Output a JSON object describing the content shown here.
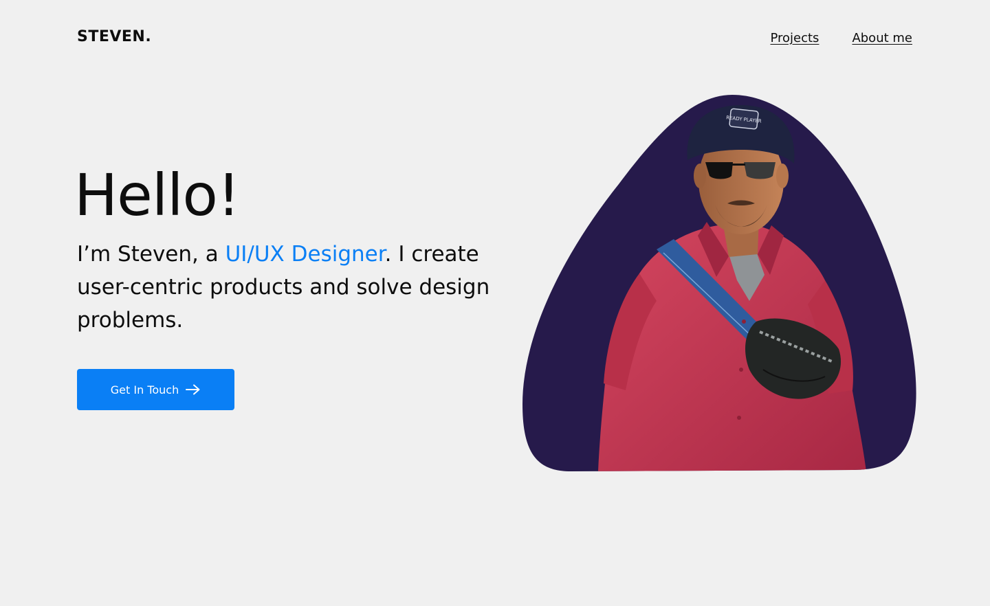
{
  "header": {
    "logo": "STEVEN.",
    "nav": [
      {
        "label": "Projects"
      },
      {
        "label": "About me"
      }
    ]
  },
  "hero": {
    "title": "Hello!",
    "intro_prefix": "I’m Steven, a ",
    "intro_accent": "UI/UX Designer",
    "intro_suffix": ". I  create user-centric products and solve design problems.",
    "cta_label": "Get In Touch",
    "cta_icon": "arrow-right-icon"
  },
  "illustration": {
    "subject": "avatar-illustration",
    "beanie_text": "READY PLAYER"
  },
  "colors": {
    "background": "#f0f0f0",
    "accent": "#0a7ff5",
    "blob": "#261a4b",
    "shirt": "#c2344e",
    "text": "#0d0d0d"
  }
}
